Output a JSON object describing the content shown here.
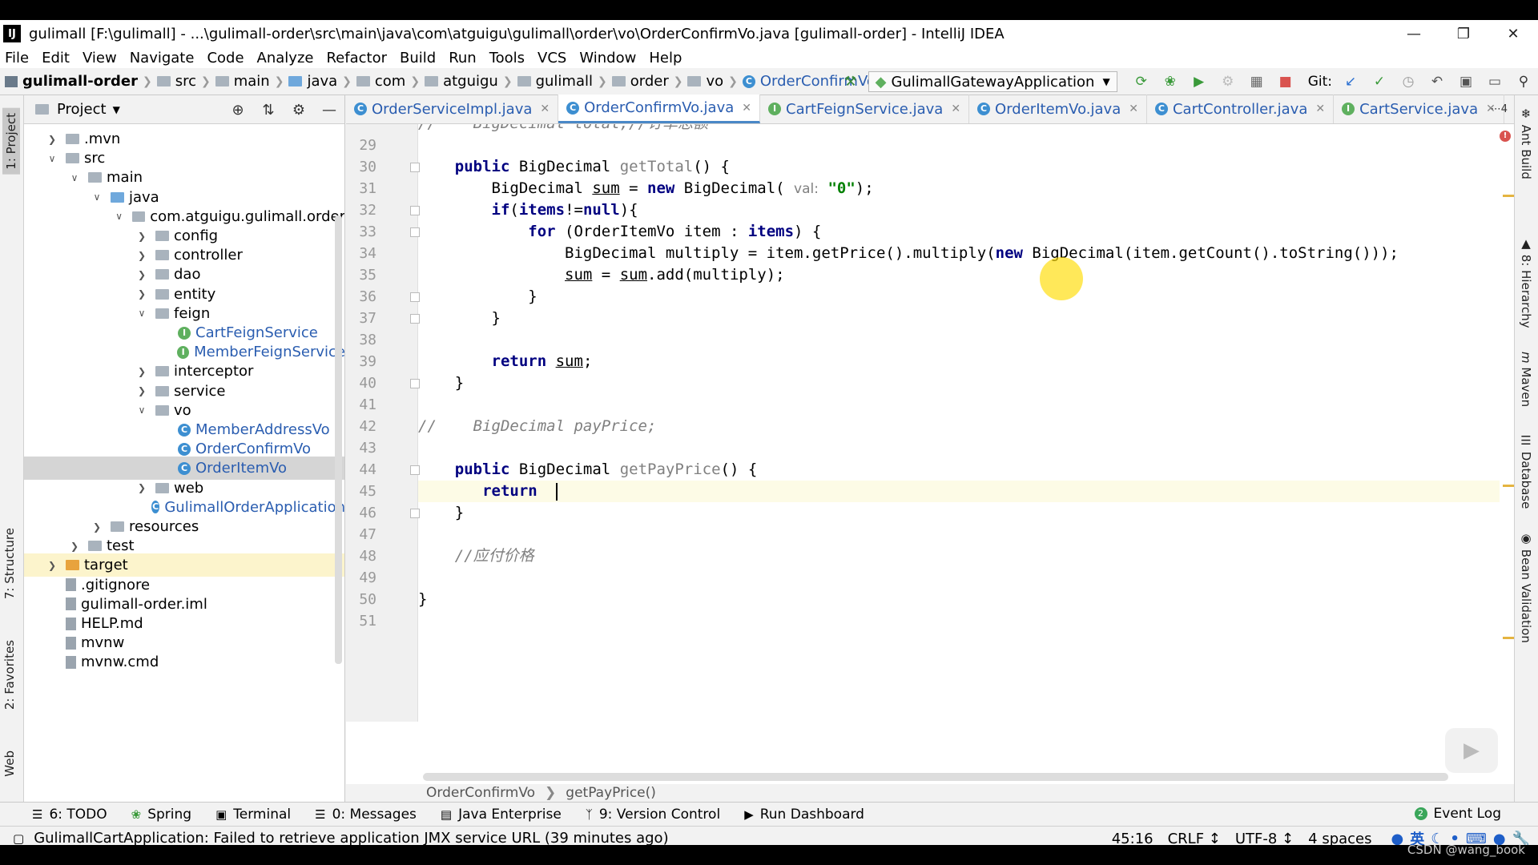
{
  "window": {
    "title": "gulimall [F:\\gulimall] - ...\\gulimall-order\\src\\main\\java\\com\\atguigu\\gulimall\\order\\vo\\OrderConfirmVo.java [gulimall-order] - IntelliJ IDEA",
    "logo": "IJ"
  },
  "menu": [
    "File",
    "Edit",
    "View",
    "Navigate",
    "Code",
    "Analyze",
    "Refactor",
    "Build",
    "Run",
    "Tools",
    "VCS",
    "Window",
    "Help"
  ],
  "breadcrumb": [
    "gulimall-order",
    "src",
    "main",
    "java",
    "com",
    "atguigu",
    "gulimall",
    "order",
    "vo",
    "OrderConfirmVo"
  ],
  "run_config": "GulimallGatewayApplication",
  "git_label": "Git:",
  "project_panel": {
    "title": "Project",
    "tree": [
      {
        "label": ".mvn",
        "indent": 1,
        "arrow": "right",
        "icon": "folder"
      },
      {
        "label": "src",
        "indent": 1,
        "arrow": "down",
        "icon": "folder"
      },
      {
        "label": "main",
        "indent": 2,
        "arrow": "down",
        "icon": "folder"
      },
      {
        "label": "java",
        "indent": 3,
        "arrow": "down",
        "icon": "folder-blue"
      },
      {
        "label": "com.atguigu.gulimall.order",
        "indent": 4,
        "arrow": "down",
        "icon": "folder"
      },
      {
        "label": "config",
        "indent": 5,
        "arrow": "right",
        "icon": "folder"
      },
      {
        "label": "controller",
        "indent": 5,
        "arrow": "right",
        "icon": "folder"
      },
      {
        "label": "dao",
        "indent": 5,
        "arrow": "right",
        "icon": "folder"
      },
      {
        "label": "entity",
        "indent": 5,
        "arrow": "right",
        "icon": "folder"
      },
      {
        "label": "feign",
        "indent": 5,
        "arrow": "down",
        "icon": "folder"
      },
      {
        "label": "CartFeignService",
        "indent": 6,
        "arrow": "",
        "icon": "interface"
      },
      {
        "label": "MemberFeignService",
        "indent": 6,
        "arrow": "",
        "icon": "interface"
      },
      {
        "label": "interceptor",
        "indent": 5,
        "arrow": "right",
        "icon": "folder"
      },
      {
        "label": "service",
        "indent": 5,
        "arrow": "right",
        "icon": "folder"
      },
      {
        "label": "vo",
        "indent": 5,
        "arrow": "down",
        "icon": "folder"
      },
      {
        "label": "MemberAddressVo",
        "indent": 6,
        "arrow": "",
        "icon": "class"
      },
      {
        "label": "OrderConfirmVo",
        "indent": 6,
        "arrow": "",
        "icon": "class"
      },
      {
        "label": "OrderItemVo",
        "indent": 6,
        "arrow": "",
        "icon": "class",
        "selected": true
      },
      {
        "label": "web",
        "indent": 5,
        "arrow": "right",
        "icon": "folder"
      },
      {
        "label": "GulimallOrderApplication",
        "indent": 5,
        "arrow": "",
        "icon": "class"
      },
      {
        "label": "resources",
        "indent": 3,
        "arrow": "right",
        "icon": "folder"
      },
      {
        "label": "test",
        "indent": 2,
        "arrow": "right",
        "icon": "folder"
      },
      {
        "label": "target",
        "indent": 1,
        "arrow": "right",
        "icon": "folder-orange",
        "highlight": true
      },
      {
        "label": ".gitignore",
        "indent": 1,
        "arrow": "",
        "icon": "file"
      },
      {
        "label": "gulimall-order.iml",
        "indent": 1,
        "arrow": "",
        "icon": "file"
      },
      {
        "label": "HELP.md",
        "indent": 1,
        "arrow": "",
        "icon": "file"
      },
      {
        "label": "mvnw",
        "indent": 1,
        "arrow": "",
        "icon": "file"
      },
      {
        "label": "mvnw.cmd",
        "indent": 1,
        "arrow": "",
        "icon": "file"
      }
    ]
  },
  "left_tabs": [
    "1: Project",
    "7: Structure",
    "2: Favorites",
    "Web"
  ],
  "right_tabs": [
    "Ant Build",
    "8: Hierarchy",
    "Maven",
    "Database",
    "Bean Validation"
  ],
  "editor_tabs": [
    {
      "label": "OrderServiceImpl.java",
      "icon": "class"
    },
    {
      "label": "OrderConfirmVo.java",
      "icon": "class",
      "active": true
    },
    {
      "label": "CartFeignService.java",
      "icon": "interface"
    },
    {
      "label": "OrderItemVo.java",
      "icon": "class"
    },
    {
      "label": "CartController.java",
      "icon": "class"
    },
    {
      "label": "CartService.java",
      "icon": "interface"
    }
  ],
  "tab_overflow": "⋯4",
  "code": {
    "top_partial": "//    BigDecimal total;//订单总额",
    "line_numbers": [
      "29",
      "30",
      "31",
      "32",
      "33",
      "34",
      "35",
      "36",
      "37",
      "38",
      "39",
      "40",
      "41",
      "42",
      "43",
      "44",
      "45",
      "46",
      "47",
      "48",
      "49",
      "50",
      "51"
    ],
    "param_hint": "val:",
    "string_zero": "\"0\"",
    "comment_pay_price": "//    BigDecimal payPrice;",
    "comment_cn": "//应付价格"
  },
  "editor_breadcrumb": [
    "OrderConfirmVo",
    "getPayPrice()"
  ],
  "bottom_tools": [
    "6: TODO",
    "Spring",
    "Terminal",
    "0: Messages",
    "Java Enterprise",
    "9: Version Control",
    "Run Dashboard"
  ],
  "event_log": "Event Log",
  "status": {
    "message": "GulimallCartApplication: Failed to retrieve application JMX service URL (39 minutes ago)",
    "position": "45:16",
    "line_sep": "CRLF ↕",
    "encoding": "UTF-8 ↕",
    "indent": "4 spaces",
    "ime_lang": "英"
  },
  "watermark": "CSDN @wang_book"
}
